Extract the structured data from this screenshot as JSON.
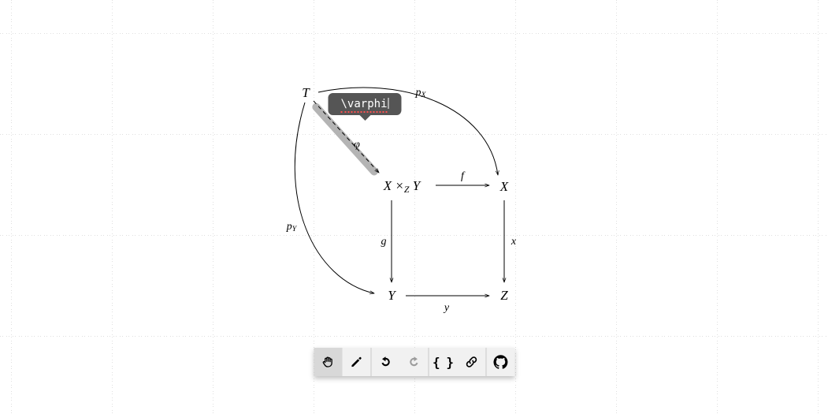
{
  "nodes": {
    "T": {
      "label": "T"
    },
    "XY": {
      "plain": "X ×",
      "sub": "Z",
      "tail": " Y"
    },
    "X": {
      "label": "X"
    },
    "Y": {
      "label": "Y"
    },
    "Z": {
      "label": "Z"
    }
  },
  "edges": {
    "phi": {
      "label": "φ"
    },
    "pX": {
      "plain": "p",
      "sub": "X"
    },
    "pY": {
      "plain": "p",
      "sub": "Y"
    },
    "f": {
      "label": "f"
    },
    "g": {
      "label": "g"
    },
    "x": {
      "label": "x"
    },
    "y": {
      "label": "y"
    }
  },
  "tooltip": {
    "value": "\\varphi"
  },
  "toolbar": {
    "pan": "Pan",
    "draw": "Draw",
    "undo": "Undo",
    "redo": "Redo",
    "source": "Show source",
    "link": "Share link",
    "github": "GitHub"
  },
  "chart_data": {
    "type": "diagram",
    "description": "Commutative diagram: pullback of X and Y over Z with universal object T",
    "objects": [
      {
        "id": "T",
        "label": "T"
      },
      {
        "id": "XY",
        "label": "X ×_Z Y"
      },
      {
        "id": "X",
        "label": "X"
      },
      {
        "id": "Y",
        "label": "Y"
      },
      {
        "id": "Z",
        "label": "Z"
      }
    ],
    "morphisms": [
      {
        "from": "T",
        "to": "XY",
        "label": "φ",
        "tex": "\\varphi",
        "style": "dashed",
        "selected": true
      },
      {
        "from": "T",
        "to": "X",
        "label": "p_X",
        "style": "curved"
      },
      {
        "from": "T",
        "to": "Y",
        "label": "p_Y",
        "style": "curved"
      },
      {
        "from": "XY",
        "to": "X",
        "label": "f"
      },
      {
        "from": "XY",
        "to": "Y",
        "label": "g"
      },
      {
        "from": "X",
        "to": "Z",
        "label": "x"
      },
      {
        "from": "Y",
        "to": "Z",
        "label": "y"
      }
    ]
  }
}
